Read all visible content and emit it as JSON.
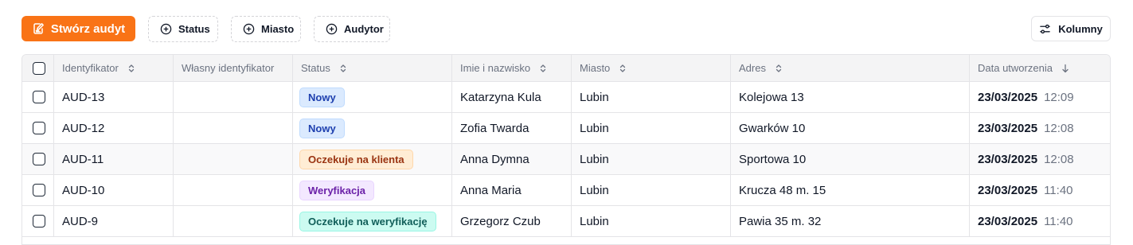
{
  "toolbar": {
    "create_label": "Stwórz audyt",
    "filters": [
      "Status",
      "Miasto",
      "Audytor"
    ],
    "columns_label": "Kolumny"
  },
  "table": {
    "headers": {
      "id": "Identyfikator",
      "custom_id": "Własny identyfikator",
      "status": "Status",
      "name": "Imie i nazwisko",
      "city": "Miasto",
      "address": "Adres",
      "created": "Data utworzenia"
    },
    "rows": [
      {
        "id": "AUD-13",
        "custom_id": "",
        "status": "Nowy",
        "status_color": "blue",
        "name": "Katarzyna Kula",
        "city": "Lubin",
        "address": "Kolejowa 13",
        "date": "23/03/2025",
        "time": "12:09"
      },
      {
        "id": "AUD-12",
        "custom_id": "",
        "status": "Nowy",
        "status_color": "blue",
        "name": "Zofia Twarda",
        "city": "Lubin",
        "address": "Gwarków 10",
        "date": "23/03/2025",
        "time": "12:08"
      },
      {
        "id": "AUD-11",
        "custom_id": "",
        "status": "Oczekuje na klienta",
        "status_color": "orange",
        "name": "Anna Dymna",
        "city": "Lubin",
        "address": "Sportowa 10",
        "date": "23/03/2025",
        "time": "12:08"
      },
      {
        "id": "AUD-10",
        "custom_id": "",
        "status": "Weryfikacja",
        "status_color": "purple",
        "name": "Anna Maria",
        "city": "Lubin",
        "address": "Krucza 48 m. 15",
        "date": "23/03/2025",
        "time": "11:40"
      },
      {
        "id": "AUD-9",
        "custom_id": "",
        "status": "Oczekuje na weryfikację",
        "status_color": "teal",
        "name": "Grzegorz Czub",
        "city": "Lubin",
        "address": "Pawia 35 m. 32",
        "date": "23/03/2025",
        "time": "11:40"
      }
    ]
  }
}
